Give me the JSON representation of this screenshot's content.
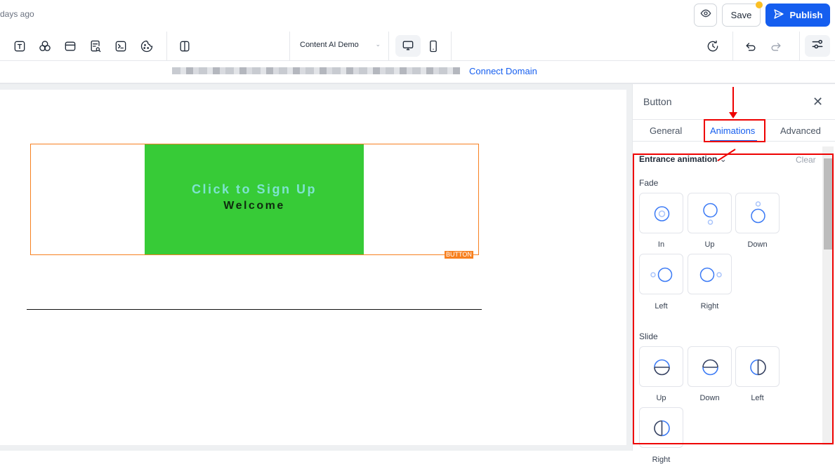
{
  "header": {
    "last_saved": "days ago",
    "save_label": "Save",
    "publish_label": "Publish",
    "unsaved_dot_color": "#fbbf24",
    "publish_color": "#155eef"
  },
  "toolbar": {
    "site_select": "Content AI Demo"
  },
  "urlbar": {
    "connect_domain": "Connect Domain"
  },
  "canvas": {
    "button_title": "Click to Sign Up",
    "button_subtitle": "Welcome",
    "element_tag": "BUTTON",
    "button_bg": "#37cb37",
    "title_color": "#7ee3d0",
    "selection_color": "#f7801f"
  },
  "panel": {
    "title": "Button",
    "tabs": [
      {
        "label": "General"
      },
      {
        "label": "Animations",
        "active": true
      },
      {
        "label": "Advanced"
      }
    ],
    "section_title": "Entrance animation",
    "clear_label": "Clear",
    "groups": [
      {
        "label": "Fade",
        "items": [
          {
            "label": "In"
          },
          {
            "label": "Up"
          },
          {
            "label": "Down"
          },
          {
            "label": "Left"
          },
          {
            "label": "Right"
          }
        ]
      },
      {
        "label": "Slide",
        "items": [
          {
            "label": "Up"
          },
          {
            "label": "Down"
          },
          {
            "label": "Left"
          },
          {
            "label": "Right"
          }
        ]
      }
    ]
  }
}
